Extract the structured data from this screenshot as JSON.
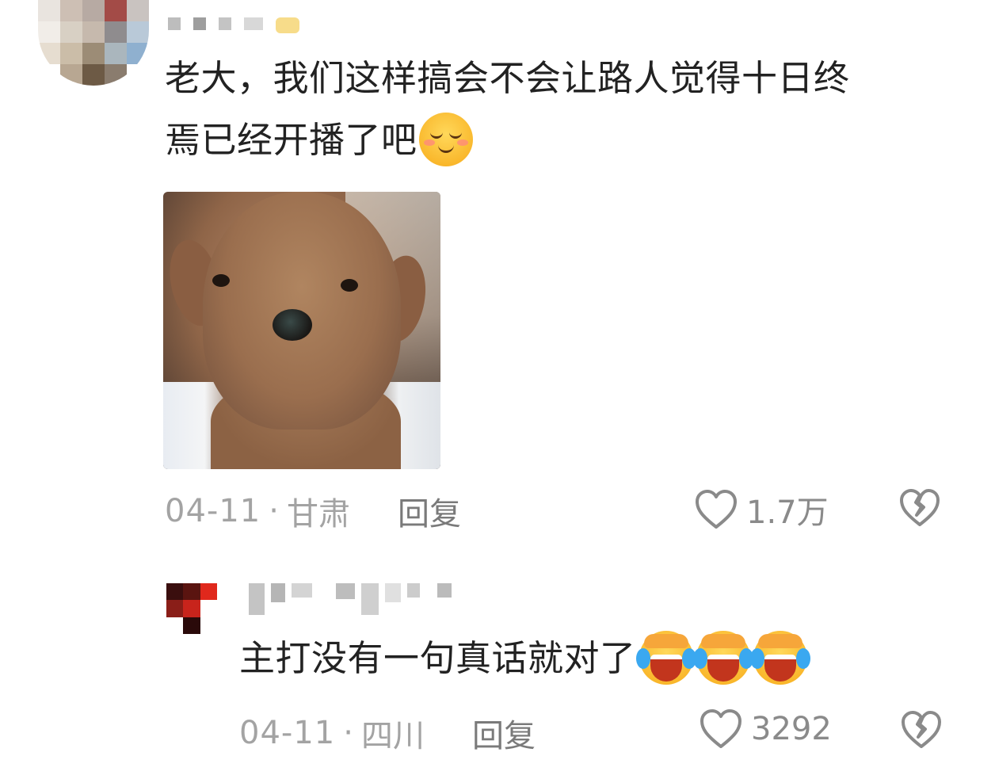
{
  "comment": {
    "text_line1": "老大，我们这样搞会不会让路人觉得十日终",
    "text_line2": "焉已经开播了吧",
    "emoji": "shy-smile-emoji",
    "image_alt": "dog-meme-photo",
    "date": "04-11",
    "separator": "·",
    "location": "甘肃",
    "reply_label": "回复",
    "like_count": "1.7万"
  },
  "reply": {
    "text": "主打没有一句真话就对了",
    "emojis": [
      "laugh-cry-emoji",
      "laugh-cry-emoji",
      "laugh-cry-emoji"
    ],
    "date": "04-11",
    "separator": "·",
    "location": "四川",
    "reply_label": "回复",
    "like_count": "3292"
  },
  "icons": {
    "like": "heart-outline-icon",
    "dislike": "broken-heart-icon"
  },
  "colors": {
    "text_primary": "#222222",
    "text_meta": "#a3a3a3",
    "reply_action": "#7a7a7a",
    "icon": "#8a8a8a"
  }
}
